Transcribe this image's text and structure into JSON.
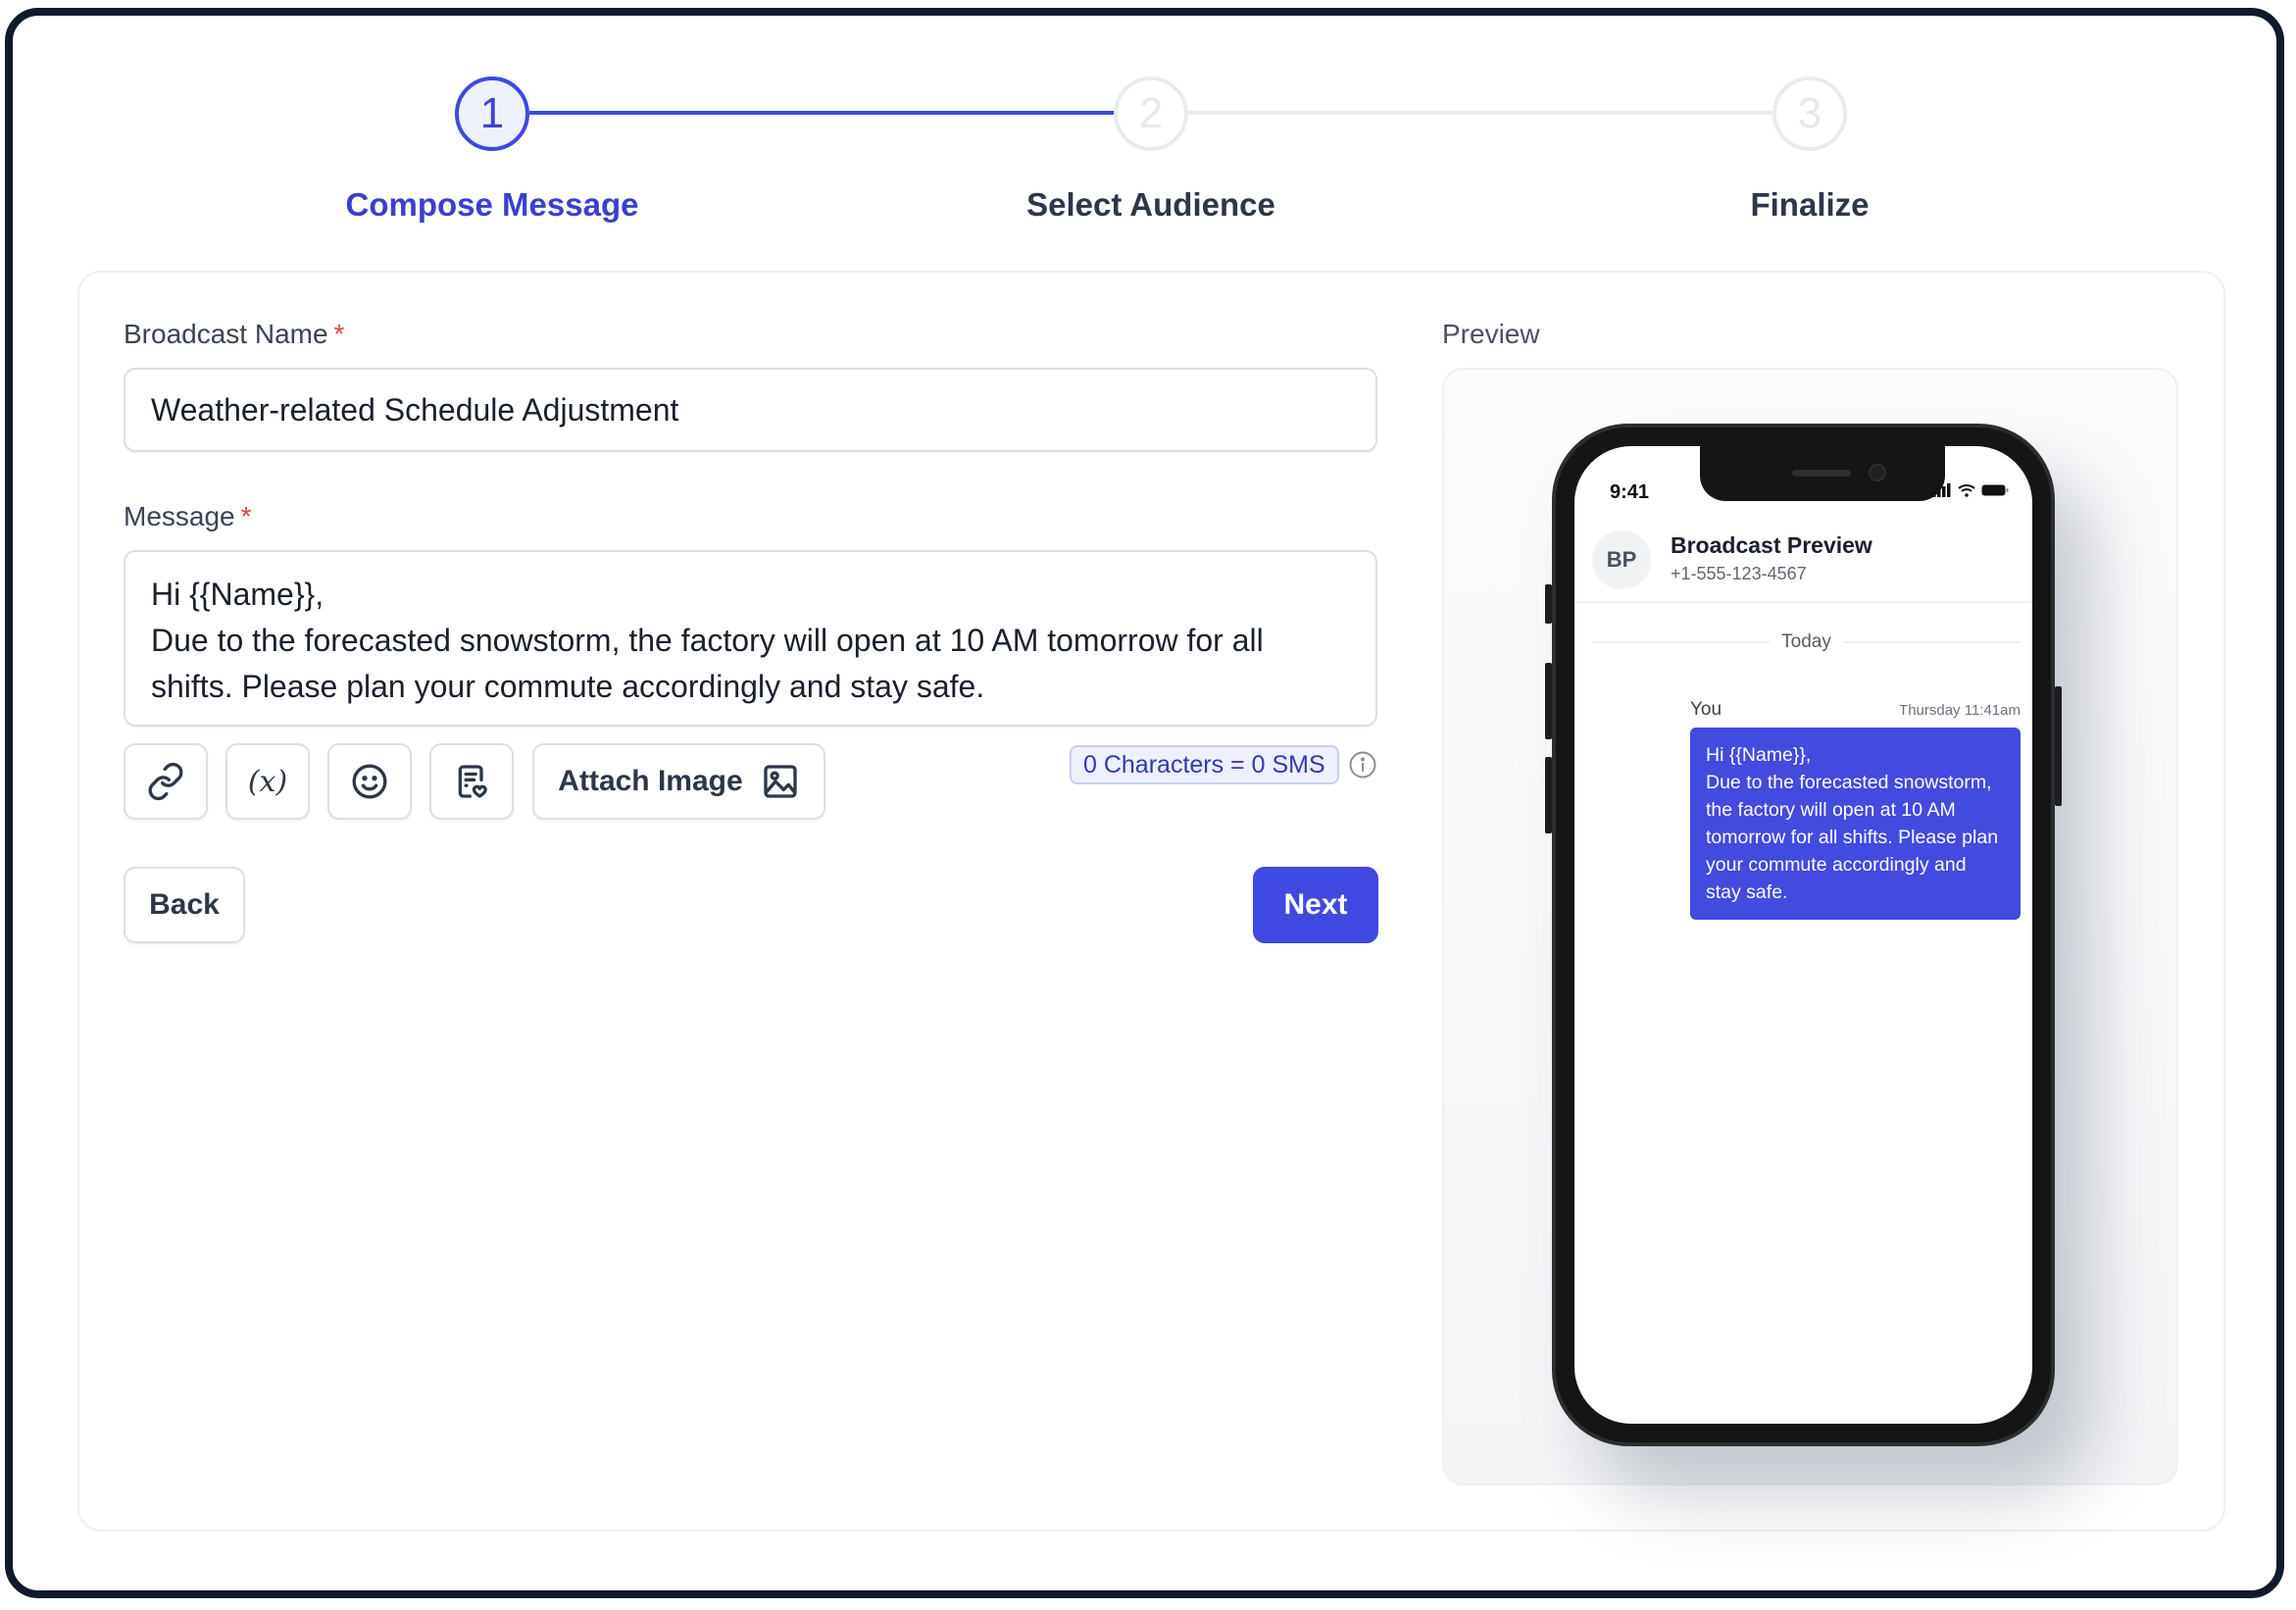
{
  "stepper": {
    "steps": [
      {
        "number": "1",
        "label": "Compose Message",
        "state": "active"
      },
      {
        "number": "2",
        "label": "Select Audience",
        "state": "inactive"
      },
      {
        "number": "3",
        "label": "Finalize",
        "state": "inactive"
      }
    ]
  },
  "form": {
    "broadcast_name_label": "Broadcast Name",
    "broadcast_name_value": "Weather-related Schedule Adjustment",
    "message_label": "Message",
    "message_value": "Hi {{Name}},\nDue to the forecasted snowstorm, the factory will open at 10 AM tomorrow for all shifts. Please plan your commute accordingly and stay safe.",
    "required_marker": "*",
    "toolbar": {
      "link_icon": "link-icon",
      "variable_icon": "variable-icon",
      "variable_glyph": "(x)",
      "emoji_icon": "smiley-icon",
      "template_icon": "template-icon",
      "attach_label": "Attach Image",
      "attach_icon": "image-icon"
    },
    "counter_text": "0 Characters = 0 SMS",
    "info_icon": "info-icon"
  },
  "actions": {
    "back_label": "Back",
    "next_label": "Next"
  },
  "preview": {
    "label": "Preview",
    "phone": {
      "status_time": "9:41",
      "avatar_initials": "BP",
      "contact_name": "Broadcast Preview",
      "contact_phone": "+1-555-123-4567",
      "date_divider": "Today",
      "sender": "You",
      "timestamp": "Thursday 11:41am",
      "message": "Hi {{Name}},\nDue to the forecasted snowstorm, the factory will open at 10 AM tomorrow for all shifts. Please plan your commute accordingly and stay safe."
    }
  },
  "colors": {
    "accent": "#4049e0",
    "required": "#e53e3e",
    "frame": "#0f1a2a",
    "bubble": "#424ae0"
  }
}
